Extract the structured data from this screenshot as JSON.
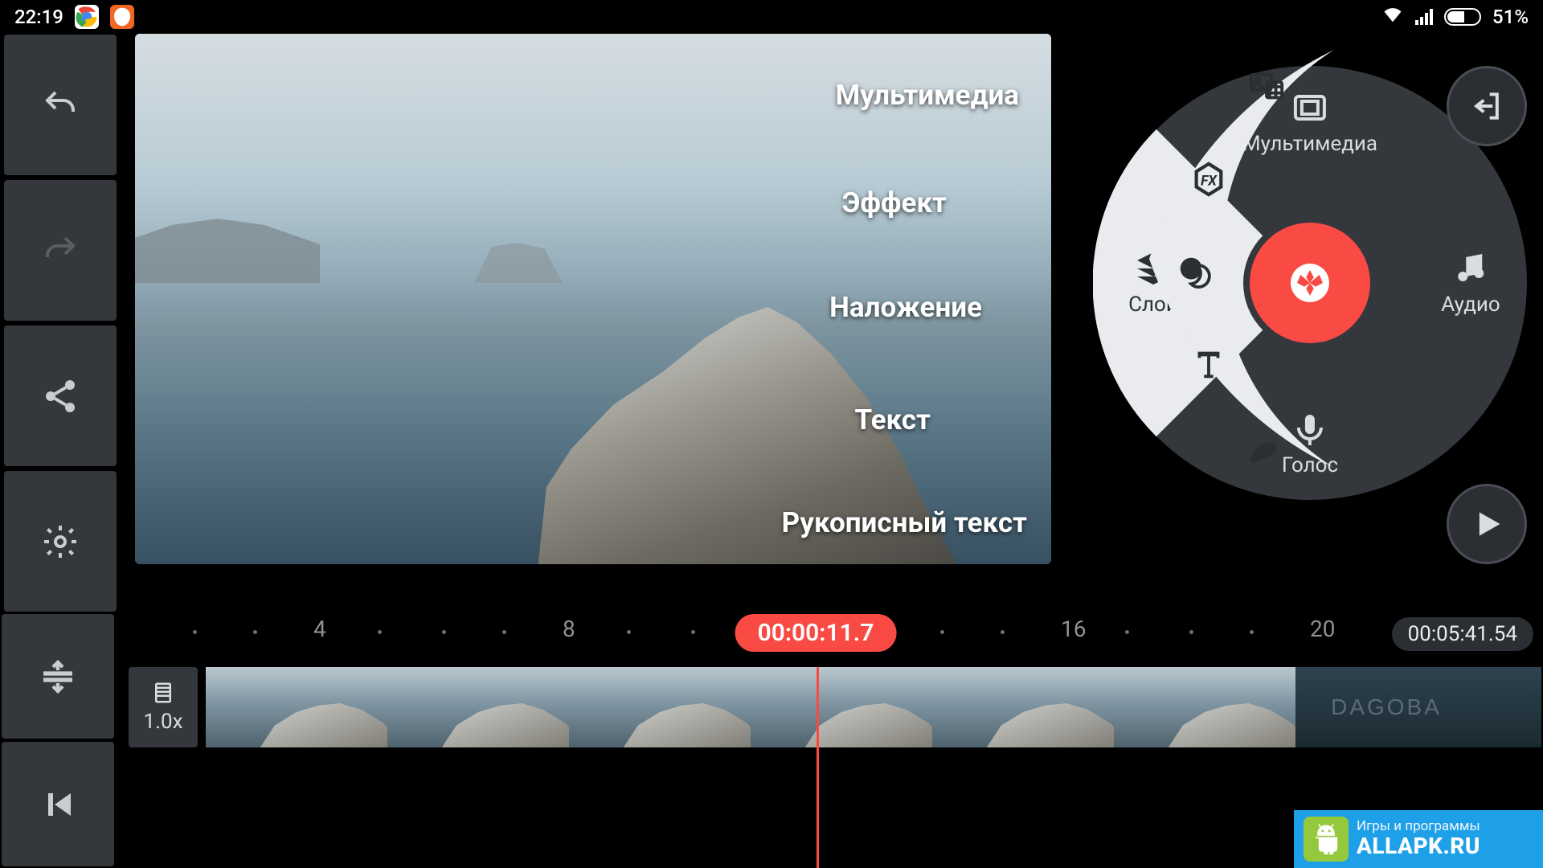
{
  "statusbar": {
    "time": "22:19",
    "battery": "51%"
  },
  "sidebar": {
    "undo": "undo",
    "redo": "redo",
    "share": "share",
    "settings": "settings",
    "expand": "expand",
    "jumpstart": "jump-start"
  },
  "preview_labels": {
    "multimedia": "Мультимедиа",
    "effect": "Эффект",
    "overlay": "Наложение",
    "text": "Текст",
    "handwriting": "Рукописный текст"
  },
  "wheel": {
    "top": "Мультимедиа",
    "left": "Слой",
    "right": "Аудио",
    "bottom": "Голос"
  },
  "fan": {
    "multimedia": "media",
    "effect": "fx",
    "overlay": "overlay",
    "text": "text",
    "hand": "handwriting"
  },
  "timeline": {
    "speed": "1.0x",
    "ticks": [
      "4",
      "8",
      "16",
      "20"
    ],
    "playhead": "00:00:11.7",
    "duration": "00:05:41.54",
    "clip_title": "DAGOBA"
  },
  "watermark": {
    "small": "Игры и программы",
    "big": "ALLAPK.RU"
  }
}
